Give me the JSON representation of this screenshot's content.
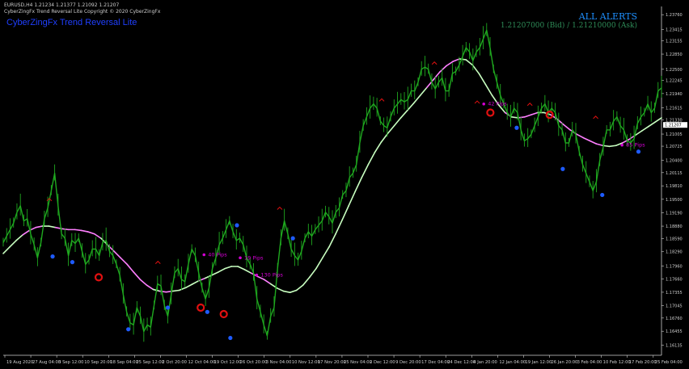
{
  "header": {
    "symbol_line": "EURUSD,H4  1.21234 1.21377 1.21092 1.21207",
    "copyright_line": "CyberZingFx Trend Reversal Lite Copyright © 2020 CyberZingFx"
  },
  "indicator_title": "CyberZingFx Trend Reversal Lite",
  "alerts": {
    "title": "ALL ALERTS",
    "prices": "1.21207000 (Bid) / 1.21210000 (Ask)"
  },
  "colors": {
    "price": "#1fa81f",
    "ma_pink": "#ff7fff",
    "ma_green": "#c8ffc0",
    "buy": "#1e5bff",
    "sell": "#e01010",
    "pips": "#d400d4",
    "axis": "#d0d0d0"
  },
  "chart_data": {
    "type": "line",
    "ylim": [
      1.159,
      1.2395
    ],
    "yticks": [
      "1.23760",
      "1.23415",
      "1.23155",
      "1.22850",
      "1.22500",
      "1.22245",
      "1.21940",
      "1.21615",
      "1.21330",
      "1.21005",
      "1.20725",
      "1.20400",
      "1.20115",
      "1.19810",
      "1.19500",
      "1.19190",
      "1.18880",
      "1.18590",
      "1.18290",
      "1.17960",
      "1.17660",
      "1.17355",
      "1.17045",
      "1.16760",
      "1.16455",
      "1.16135",
      "1.15830"
    ],
    "current_price": "1.21207",
    "xticks": [
      "19 Aug 2020",
      "27 Aug 04:00",
      "3 Sep 12:00",
      "10 Sep 20:00",
      "18 Sep 04:00",
      "25 Sep 12:00",
      "2 Oct 20:00",
      "12 Oct 04:00",
      "19 Oct 12:00",
      "26 Oct 20:00",
      "3 Nov 04:00",
      "10 Nov 12:00",
      "17 Nov 20:00",
      "25 Nov 04:00",
      "2 Dec 12:00",
      "9 Dec 20:00",
      "17 Dec 04:00",
      "24 Dec 12:00",
      "4 Jan 20:00",
      "12 Jan 04:00",
      "19 Jan 12:00",
      "26 Jan 20:00",
      "3 Feb 04:00",
      "10 Feb 12:00",
      "17 Feb 20:00",
      "25 Feb 04:00"
    ],
    "series": [
      {
        "values": [
          1.185,
          1.1865,
          1.188,
          1.1895,
          1.192,
          1.1935,
          1.19,
          1.1905,
          1.187,
          1.1845,
          1.1815,
          1.185,
          1.1905,
          1.193,
          1.197,
          1.201,
          1.1935,
          1.187,
          1.186,
          1.182,
          1.1855,
          1.1848,
          1.186,
          1.183,
          1.18,
          1.181,
          1.1835,
          1.1835,
          1.182,
          1.185,
          1.1855,
          1.183,
          1.182,
          1.18,
          1.1775,
          1.173,
          1.169,
          1.1665,
          1.166,
          1.17,
          1.168,
          1.1645,
          1.166,
          1.1655,
          1.1705,
          1.1755,
          1.175,
          1.1705,
          1.168,
          1.173,
          1.178,
          1.179,
          1.1765,
          1.176,
          1.18,
          1.1835,
          1.182,
          1.178,
          1.1745,
          1.172,
          1.1745,
          1.179,
          1.1815,
          1.1845,
          1.186,
          1.188,
          1.19,
          1.1875,
          1.1855,
          1.186,
          1.1845,
          1.1815,
          1.18,
          1.178,
          1.172,
          1.169,
          1.166,
          1.1635,
          1.168,
          1.17,
          1.179,
          1.186,
          1.19,
          1.187,
          1.1835,
          1.182,
          1.181,
          1.183,
          1.186,
          1.1875,
          1.1865,
          1.188,
          1.189,
          1.19,
          1.192,
          1.191,
          1.1895,
          1.192,
          1.193,
          1.196,
          1.197,
          1.2,
          1.201,
          1.203,
          1.208,
          1.212,
          1.214,
          1.216,
          1.217,
          1.216,
          1.213,
          1.212,
          1.2115,
          1.214,
          1.216,
          1.217,
          1.218,
          1.2175,
          1.218,
          1.22,
          1.22,
          1.222,
          1.225,
          1.2255,
          1.225,
          1.222,
          1.2205,
          1.222,
          1.223,
          1.22,
          1.22,
          1.224,
          1.2245,
          1.226,
          1.228,
          1.23,
          1.229,
          1.227,
          1.229,
          1.23,
          1.232,
          1.234,
          1.23,
          1.225,
          1.222,
          1.219,
          1.217,
          1.215,
          1.214,
          1.216,
          1.215,
          1.211,
          1.2085,
          1.209,
          1.21,
          1.212,
          1.214,
          1.216,
          1.217,
          1.215,
          1.216,
          1.215,
          1.212,
          1.211,
          1.208,
          1.208,
          1.211,
          1.21,
          1.206,
          1.203,
          1.201,
          1.199,
          1.197,
          1.199,
          1.204,
          1.207,
          1.211,
          1.211,
          1.213,
          1.214,
          1.212,
          1.211,
          1.2085,
          1.208,
          1.209,
          1.2125,
          1.214,
          1.215,
          1.217,
          1.215,
          1.216,
          1.22,
          1.2207
        ]
      },
      {
        "values": [
          1.1825,
          1.184,
          1.1855,
          1.1868,
          1.1878,
          1.1885,
          1.1888,
          1.1888,
          1.1885,
          1.1882,
          1.188,
          1.188,
          1.1878,
          1.1875,
          1.187,
          1.186,
          1.1845,
          1.183,
          1.1815,
          1.18,
          1.1782,
          1.1765,
          1.1752,
          1.1742,
          1.1738,
          1.1736,
          1.1738,
          1.174,
          1.1746,
          1.1754,
          1.1762,
          1.1768,
          1.1775,
          1.1782,
          1.179,
          1.1795,
          1.1795,
          1.1788,
          1.178,
          1.1772,
          1.1765,
          1.1755,
          1.1745,
          1.1738,
          1.1735,
          1.174,
          1.1752,
          1.177,
          1.179,
          1.1815,
          1.184,
          1.187,
          1.1902,
          1.1935,
          1.1968,
          1.2,
          1.203,
          1.2058,
          1.2082,
          1.2102,
          1.212,
          1.2138,
          1.2155,
          1.2172,
          1.219,
          1.2208,
          1.2226,
          1.2244,
          1.2258,
          1.2268,
          1.2274,
          1.2272,
          1.226,
          1.224,
          1.2215,
          1.219,
          1.2168,
          1.215,
          1.214,
          1.2138,
          1.214,
          1.2145,
          1.215,
          1.215,
          1.2145,
          1.2135,
          1.2122,
          1.211,
          1.21,
          1.2092,
          1.2085,
          1.2078,
          1.2074,
          1.2072,
          1.2074,
          1.208,
          1.2088,
          1.2098,
          1.2108,
          1.2118,
          1.2128,
          1.2138
        ]
      }
    ],
    "annotations": [
      {
        "x": 0.305,
        "y": 1.1822,
        "text": "40 Pips"
      },
      {
        "x": 0.36,
        "y": 1.1815,
        "text": "19 Pips"
      },
      {
        "x": 0.385,
        "y": 1.1775,
        "text": "130 Pips"
      },
      {
        "x": 0.73,
        "y": 1.217,
        "text": "42 Pips"
      },
      {
        "x": 0.94,
        "y": 1.2075,
        "text": "85 Pips"
      }
    ],
    "buy_signals": [
      [
        0.075,
        1.1818
      ],
      [
        0.105,
        1.1805
      ],
      [
        0.19,
        1.165
      ],
      [
        0.25,
        1.17
      ],
      [
        0.31,
        1.169
      ],
      [
        0.345,
        1.163
      ],
      [
        0.355,
        1.189
      ],
      [
        0.44,
        1.186
      ],
      [
        0.78,
        1.2115
      ],
      [
        0.85,
        1.202
      ],
      [
        0.91,
        1.196
      ],
      [
        0.965,
        1.206
      ]
    ],
    "sell_signals": [
      [
        0.145,
        1.177
      ],
      [
        0.3,
        1.17
      ],
      [
        0.335,
        1.1685
      ],
      [
        0.74,
        1.215
      ],
      [
        0.83,
        1.2145
      ]
    ],
    "arrow_marks": [
      [
        0.07,
        1.195
      ],
      [
        0.235,
        1.1805
      ],
      [
        0.42,
        1.193
      ],
      [
        0.575,
        1.218
      ],
      [
        0.655,
        1.2265
      ],
      [
        0.72,
        1.2175
      ],
      [
        0.8,
        1.217
      ],
      [
        0.9,
        1.214
      ]
    ]
  }
}
